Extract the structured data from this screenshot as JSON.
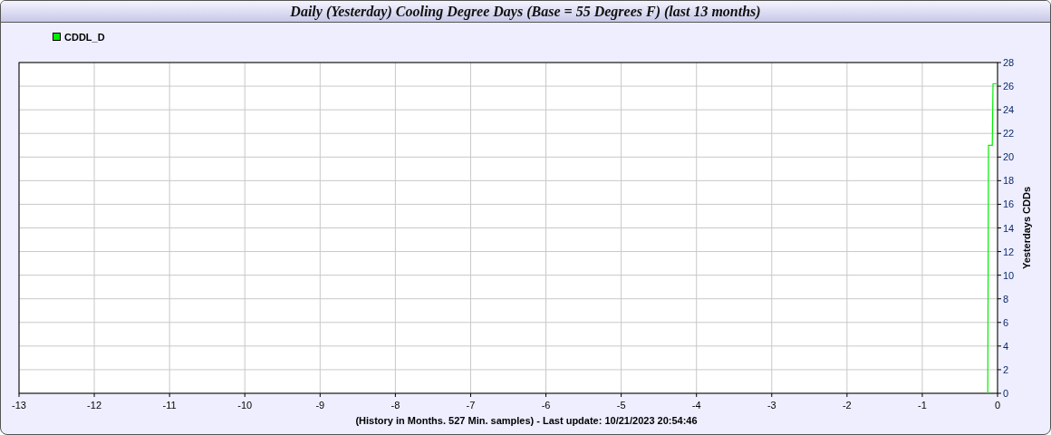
{
  "window": {
    "title": "Daily (Yesterday) Cooling Degree Days (Base = 55 Degrees F) (last 13 months)"
  },
  "chart_data": {
    "type": "line",
    "xlabel": "(History in Months. 527 Min. samples) - Last update: 10/21/2023 20:54:46",
    "ylabel": "Yesterdays CDDs",
    "x": [
      -0.13,
      -0.12,
      -0.07,
      -0.06,
      0
    ],
    "series": [
      {
        "name": "CDDL_D",
        "color": "#00ee00",
        "values": [
          0,
          21,
          21,
          26.2,
          26.2
        ]
      }
    ],
    "xlim": [
      -13,
      0
    ],
    "ylim": [
      0,
      28
    ],
    "xticks": [
      -13,
      -12,
      -11,
      -10,
      -9,
      -8,
      -7,
      -6,
      -5,
      -4,
      -3,
      -2,
      -1,
      0
    ],
    "yticks": [
      0,
      2,
      4,
      6,
      8,
      10,
      12,
      14,
      16,
      18,
      20,
      22,
      24,
      26,
      28
    ],
    "grid": true
  }
}
